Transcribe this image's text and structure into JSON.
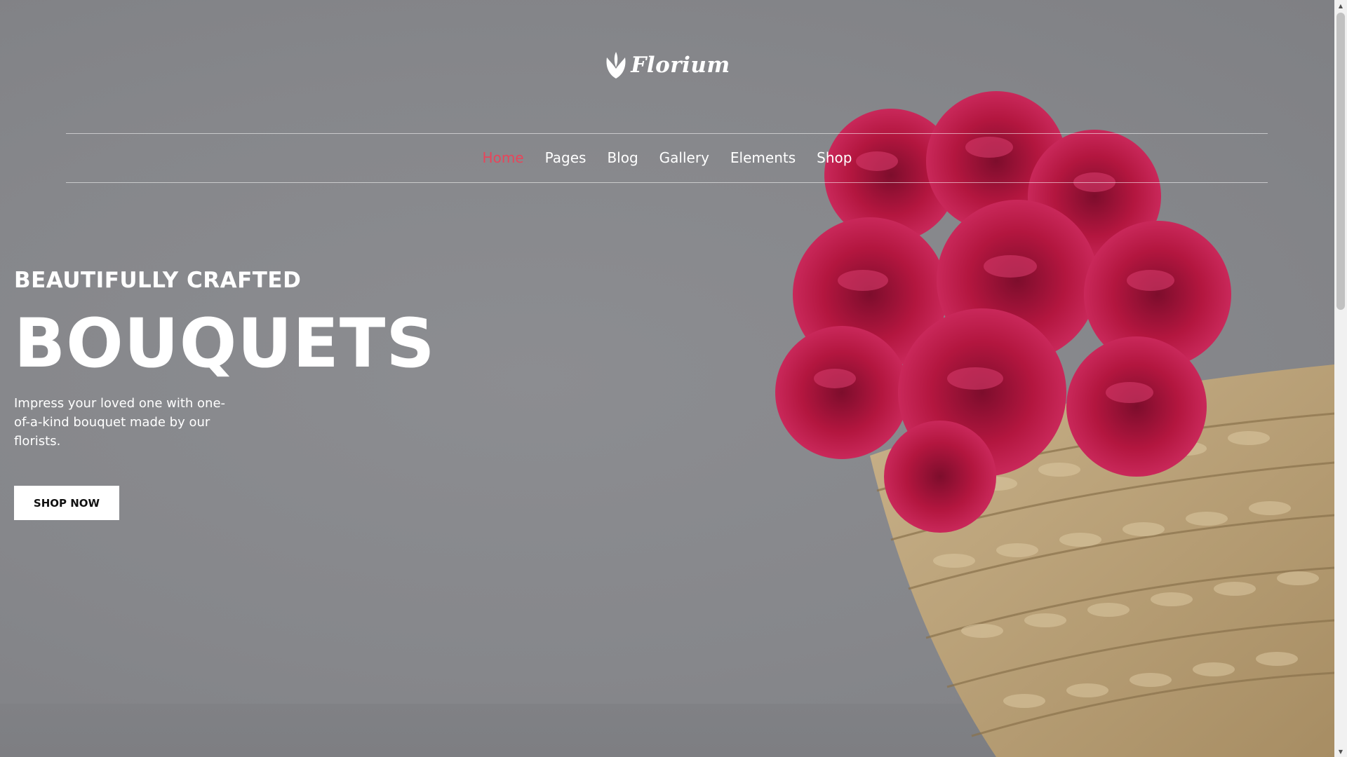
{
  "header": {
    "logo_text": "Florium"
  },
  "nav": {
    "items": [
      {
        "label": "Home",
        "active": true
      },
      {
        "label": "Pages",
        "active": false
      },
      {
        "label": "Blog",
        "active": false
      },
      {
        "label": "Gallery",
        "active": false
      },
      {
        "label": "Elements",
        "active": false
      },
      {
        "label": "Shop",
        "active": false
      }
    ]
  },
  "hero": {
    "subtitle": "BEAUTIFULLY CRAFTED",
    "title": "BOUQUETS",
    "description": "Impress your loved one with one-of-a-kind bouquet made by our florists.",
    "button_label": "SHOP NOW"
  },
  "colors": {
    "accent": "#e8455a",
    "overlay": "#86878b",
    "flower": "#c2184a"
  },
  "scrollbar": {
    "up_icon": "arrow-up-icon",
    "down_icon": "arrow-down-icon"
  }
}
